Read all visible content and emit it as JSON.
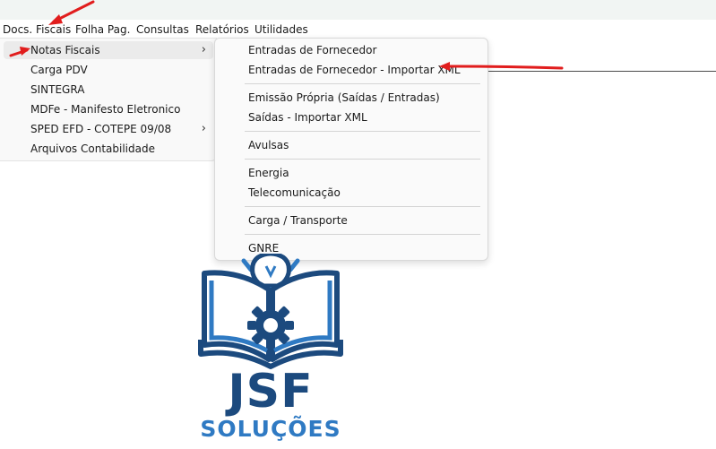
{
  "menubar": {
    "items": [
      {
        "label": "Docs. Fiscais"
      },
      {
        "label": "Folha Pag."
      },
      {
        "label": "Consultas"
      },
      {
        "label": "Relatórios"
      },
      {
        "label": "Utilidades"
      }
    ]
  },
  "main_menu": {
    "items": [
      {
        "label": "Notas Fiscais",
        "has_submenu": true,
        "highlighted": true
      },
      {
        "label": "Carga PDV"
      },
      {
        "label": "SINTEGRA"
      },
      {
        "label": "MDFe - Manifesto Eletronico"
      },
      {
        "label": "SPED EFD - COTEPE 09/08",
        "has_submenu": true
      },
      {
        "label": "Arquivos Contabilidade"
      }
    ]
  },
  "submenu": {
    "items": [
      {
        "label": "Entradas de Fornecedor"
      },
      {
        "label": "Entradas de Fornecedor - Importar XML"
      },
      {
        "label": "Emissão Própria (Saídas / Entradas)"
      },
      {
        "label": "Saídas - Importar XML"
      },
      {
        "label": "Avulsas"
      },
      {
        "label": "Energia"
      },
      {
        "label": "Telecomunicação"
      },
      {
        "label": "Carga / Transporte"
      },
      {
        "label": "GNRE"
      }
    ]
  },
  "logo": {
    "brand": "JSF",
    "tagline": "SOLUÇÕES"
  },
  "colors": {
    "annotation_arrow": "#e11d1d",
    "logo_dark_blue": "#1c4a7e",
    "logo_light_blue": "#2f7ac3",
    "menu_background": "#f9f9f9",
    "highlight": "#ebebeb"
  },
  "icons": {
    "submenu_indicator": "chevron-right-icon",
    "logo_mark": "book-gear-lightbulb-icon",
    "annotation": "red-arrow-annotation"
  }
}
